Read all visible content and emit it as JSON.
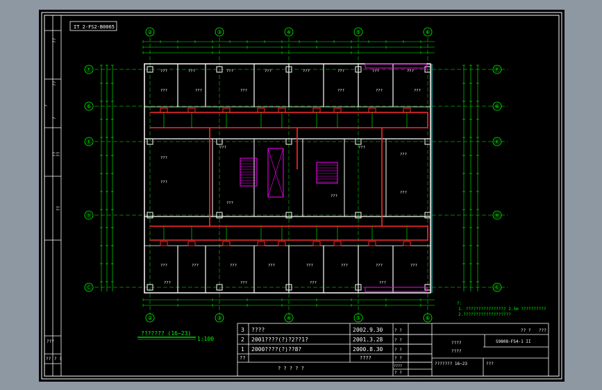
{
  "drawing": {
    "stamp": "IT 2-FS2-B0065",
    "title": "???????  (16~23)",
    "scale": "1:100",
    "axis_columns": [
      "②",
      "③",
      "④",
      "⑤",
      "⑥"
    ],
    "axis_rows": [
      "Ⓕ",
      "Ⓔ",
      "Ⓓ",
      "Ⓒ"
    ],
    "axis_mid_row": "⑥",
    "room_label": "???",
    "notes": {
      "title": "?:",
      "line1": "1. ???????????????? 2.5m ??????????",
      "line2": "2.???????????????????"
    },
    "colors": {
      "wall": "#ffffff",
      "duct": "#ff2a2a",
      "dim": "#00ff00",
      "stair": "#ff00ff",
      "grid": "#00ffff"
    }
  },
  "revisions": [
    {
      "no": "3",
      "desc": "????",
      "date": "2002.9.30"
    },
    {
      "no": "2",
      "desc": "2001????(?)?2??1?",
      "date": "2001.3.28"
    },
    {
      "no": "1",
      "desc": "2000????(?)??8?",
      "date": "2000.8.30"
    }
  ],
  "revision_footer": {
    "col1": "??",
    "col2": "????",
    "marks": "? ? ? ? ?"
  },
  "title_block": {
    "top_right_a": "?? ?",
    "top_right_b": "???",
    "q1": "? ?",
    "q2": "? ?",
    "q3": "? ?",
    "q4": "? ?",
    "q5": "????",
    "q6": "? ?",
    "project_a": "????",
    "project_b": "????",
    "drawing_no": "S9808-FS4-1 II",
    "drawing_name": "??????? 16~23",
    "sheet_label": "???"
  },
  "left_strip": {
    "labels": [
      "??",
      "??",
      "?",
      "?",
      "??",
      "??",
      "??"
    ],
    "bottom_a": "???",
    "bottom_b": "??",
    "bottom_c": "? ?"
  }
}
